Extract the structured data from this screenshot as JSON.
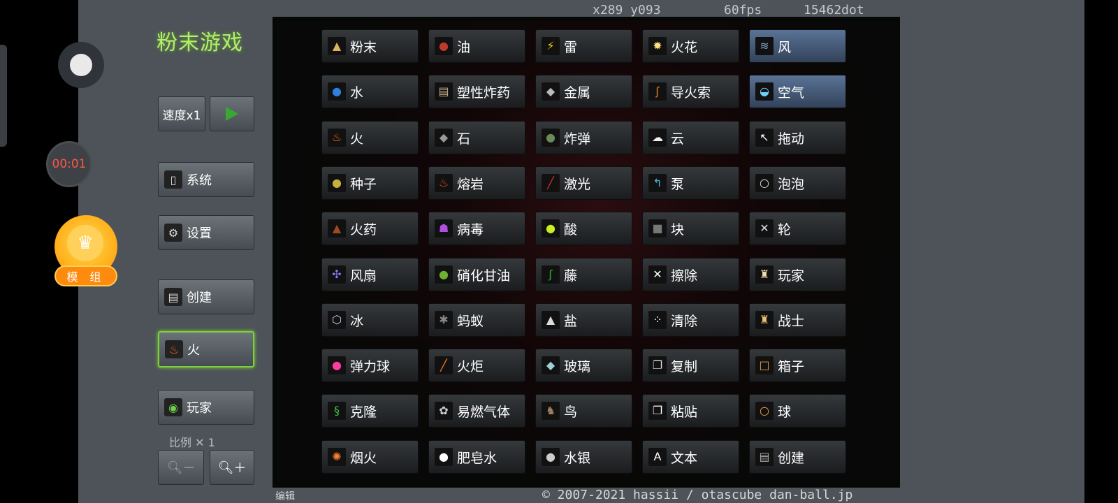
{
  "overlay": {
    "timer": "00:01",
    "mod_badge": "模 组"
  },
  "header": {
    "title": "粉末游戏",
    "coords": "x289 y093",
    "fps": "60fps",
    "dots": "15462dot"
  },
  "sidebar": {
    "speed_label": "速度x1",
    "play_icon": "play-icon",
    "system_label": "系统",
    "settings_label": "设置",
    "create_label": "创建",
    "current_element": "火",
    "player_label": "玩家",
    "scale_label": "比例 ✕ 1",
    "zoom_out_label": "－",
    "zoom_in_label": "＋"
  },
  "footer": {
    "edit_label": "编辑",
    "copyright": "© 2007-2021 hassii / otascube  dan-ball.jp"
  },
  "elements": [
    [
      "粉末",
      "油",
      "雷",
      "火花",
      "风"
    ],
    [
      "水",
      "塑性炸药",
      "金属",
      "导火索",
      "空气"
    ],
    [
      "火",
      "石",
      "炸弹",
      "云",
      "拖动"
    ],
    [
      "种子",
      "熔岩",
      "激光",
      "泵",
      "泡泡"
    ],
    [
      "火药",
      "病毒",
      "酸",
      "块",
      "轮"
    ],
    [
      "风扇",
      "硝化甘油",
      "藤",
      "擦除",
      "玩家"
    ],
    [
      "冰",
      "蚂蚁",
      "盐",
      "清除",
      "战士"
    ],
    [
      "弹力球",
      "火炬",
      "玻璃",
      "复制",
      "箱子"
    ],
    [
      "克隆",
      "易燃气体",
      "鸟",
      "粘贴",
      "球"
    ],
    [
      "烟火",
      "肥皂水",
      "水银",
      "文本",
      "创建"
    ]
  ],
  "selected": [
    "风",
    "空气"
  ],
  "icon_glyphs": [
    [
      "▲",
      "●",
      "⚡",
      "✹",
      "≋"
    ],
    [
      "●",
      "▤",
      "◆",
      "ʃ",
      "◒"
    ],
    [
      "♨",
      "◆",
      "●",
      "☁",
      "↖"
    ],
    [
      "●",
      "♨",
      "╱",
      "↰",
      "○"
    ],
    [
      "▲",
      "☗",
      "●",
      "■",
      "✕"
    ],
    [
      "✣",
      "●",
      "ʃ",
      "✕",
      "♜"
    ],
    [
      "⬡",
      "✱",
      "▲",
      "⁘",
      "♜"
    ],
    [
      "●",
      "╱",
      "◆",
      "❐",
      "□"
    ],
    [
      "§",
      "✿",
      "♞",
      "❐",
      "○"
    ],
    [
      "✺",
      "●",
      "●",
      "A",
      "▤"
    ]
  ],
  "icon_colors": [
    [
      "#e0b060",
      "#c0392b",
      "#ffd400",
      "#ffe080",
      "#7ea0c8"
    ],
    [
      "#2f7fe0",
      "#c8b48a",
      "#bbbbbb",
      "#e08030",
      "#6fd0ff"
    ],
    [
      "#ff6a1a",
      "#999999",
      "#6a8a5a",
      "#eeeeee",
      "#ffffff"
    ],
    [
      "#c8b040",
      "#e0501a",
      "#d03030",
      "#4ab0d0",
      "#dddddd"
    ],
    [
      "#a04a20",
      "#b050e0",
      "#c8f020",
      "#777777",
      "#dddddd"
    ],
    [
      "#8080ff",
      "#70b030",
      "#30b030",
      "#ffffff",
      "#eeddaa"
    ],
    [
      "#c8c8ff",
      "#888888",
      "#dddddd",
      "#ffffff",
      "#f0c070"
    ],
    [
      "#ff3ca0",
      "#ff7a20",
      "#a0d0d0",
      "#dddddd",
      "#f0a040"
    ],
    [
      "#40c040",
      "#cccccc",
      "#a08060",
      "#ffffff",
      "#f0a040"
    ],
    [
      "#ff8030",
      "#ffffff",
      "#cccccc",
      "#ffffff",
      "#aaaaaa"
    ]
  ],
  "icon_names": [
    [
      "powder-icon",
      "oil-icon",
      "thunder-icon",
      "spark-icon",
      "wind-icon"
    ],
    [
      "water-icon",
      "c4-icon",
      "metal-icon",
      "fuse-icon",
      "air-icon"
    ],
    [
      "fire-icon",
      "stone-icon",
      "bomb-icon",
      "cloud-icon",
      "drag-icon"
    ],
    [
      "seed-icon",
      "magma-icon",
      "laser-icon",
      "pump-icon",
      "bubble-icon"
    ],
    [
      "gunpowder-icon",
      "virus-icon",
      "acid-icon",
      "block-icon",
      "wheel-icon"
    ],
    [
      "fan-icon",
      "nitro-icon",
      "vine-icon",
      "erase-icon",
      "player-icon"
    ],
    [
      "ice-icon",
      "ant-icon",
      "salt-icon",
      "clear-icon",
      "fighter-icon"
    ],
    [
      "ball-icon",
      "torch-icon",
      "glass-icon",
      "copy-icon",
      "box-icon"
    ],
    [
      "clone-icon",
      "gas-icon",
      "bird-icon",
      "paste-icon",
      "ball-outline-icon"
    ],
    [
      "firework-icon",
      "soapy-water-icon",
      "mercury-icon",
      "text-icon",
      "create-icon"
    ]
  ]
}
